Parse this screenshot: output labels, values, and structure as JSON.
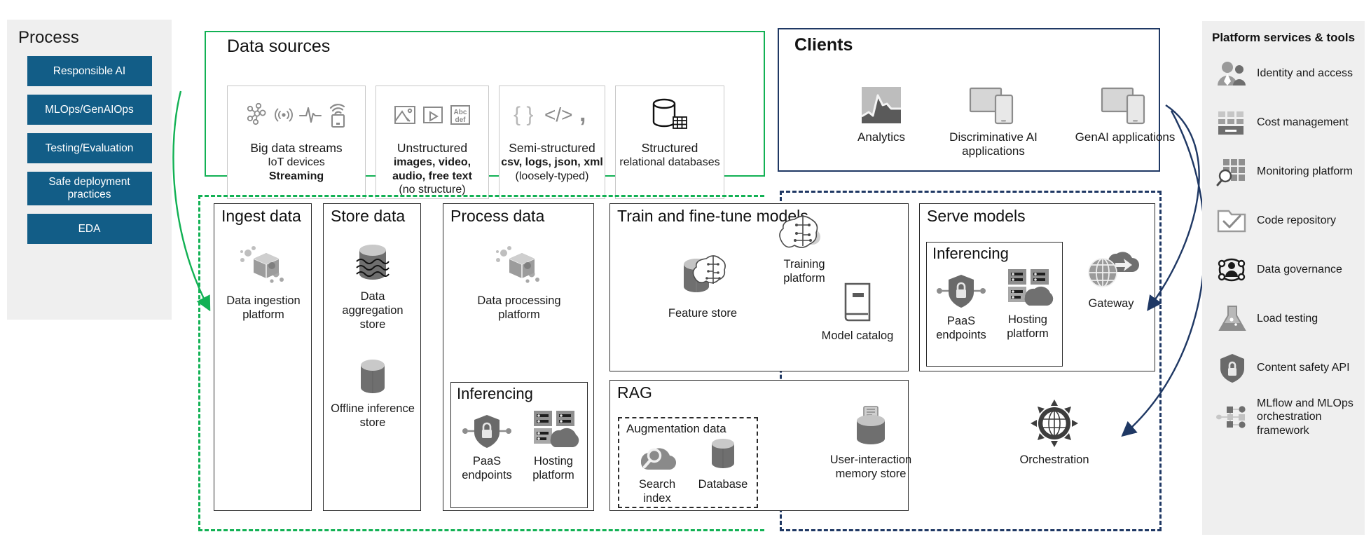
{
  "process": {
    "title": "Process",
    "items": [
      {
        "label": "Responsible AI"
      },
      {
        "label": "MLOps/GenAIOps"
      },
      {
        "label": "Testing/Evaluation"
      },
      {
        "label": "Safe deployment practices"
      },
      {
        "label": "EDA"
      }
    ]
  },
  "data_sources": {
    "title": "Data sources",
    "accent": "#12b154",
    "cards": [
      {
        "name": "big-data-streams",
        "line1": "Big data streams",
        "line2": "IoT devices",
        "line3": "Streaming",
        "icons": [
          "network-nodes-icon",
          "broadcast-signal-icon",
          "waveform-icon",
          "wifi-device-icon"
        ]
      },
      {
        "name": "unstructured",
        "line1": "Unstructured",
        "line2": "images, video, audio, free text",
        "line3": "(no structure)",
        "icons": [
          "image-icon",
          "video-icon",
          "abc-text-icon"
        ]
      },
      {
        "name": "semi-structured",
        "line1": "Semi-structured",
        "line2": "csv, logs, json, xml",
        "line3": "(loosely-typed)",
        "icons": [
          "braces-icon",
          "code-tag-icon",
          "comma-icon"
        ]
      },
      {
        "name": "structured",
        "line1": "Structured",
        "line2": "relational databases",
        "line3": "",
        "icons": [
          "database-table-icon"
        ]
      }
    ]
  },
  "clients": {
    "title": "Clients",
    "accent": "#1f3864",
    "items": [
      {
        "label": "Analytics",
        "icon": "analytics-chart-icon"
      },
      {
        "label": "Discriminative AI applications",
        "icon": "devices-icon"
      },
      {
        "label": "GenAI applications",
        "icon": "devices-icon"
      }
    ]
  },
  "workflow": {
    "green_accent": "#12b154",
    "blue_accent": "#1f3864",
    "stages": [
      {
        "name": "ingest-data",
        "title": "Ingest data",
        "nodes": [
          {
            "label": "Data ingestion platform",
            "icon": "data-ingestion-cube-icon"
          }
        ]
      },
      {
        "name": "store-data",
        "title": "Store data",
        "nodes": [
          {
            "label": "Data aggregation store",
            "icon": "data-lake-icon"
          },
          {
            "label": "Offline inference store",
            "icon": "cylinder-store-icon"
          }
        ]
      },
      {
        "name": "process-data",
        "title": "Process data",
        "nodes": [
          {
            "label": "Data processing platform",
            "icon": "data-processing-cube-icon"
          }
        ],
        "inferencing": {
          "title": "Inferencing",
          "nodes": [
            {
              "label": "PaaS endpoints",
              "icon": "shield-lock-endpoint-icon"
            },
            {
              "label": "Hosting platform",
              "icon": "server-cloud-icon"
            }
          ]
        }
      },
      {
        "name": "train-and-fine-tune-models",
        "title": "Train and fine-tune models",
        "nodes": [
          {
            "label": "Feature store",
            "icon": "feature-store-icon"
          },
          {
            "label": "Training platform",
            "icon": "brain-cloud-icon"
          },
          {
            "label": "Model catalog",
            "icon": "book-icon"
          }
        ]
      },
      {
        "name": "rag",
        "title": "RAG",
        "augmentation": {
          "title": "Augmentation data",
          "nodes": [
            {
              "label": "Search index",
              "icon": "search-cloud-icon"
            },
            {
              "label": "Database",
              "icon": "cylinder-store-icon"
            }
          ]
        },
        "nodes": [
          {
            "label": "User-interaction memory store",
            "icon": "memory-store-icon"
          },
          {
            "label": "Orchestration",
            "icon": "gear-orchestration-icon"
          }
        ]
      },
      {
        "name": "serve-models",
        "title": "Serve models",
        "inferencing": {
          "title": "Inferencing",
          "nodes": [
            {
              "label": "PaaS endpoints",
              "icon": "shield-lock-endpoint-icon"
            },
            {
              "label": "Hosting platform",
              "icon": "server-cloud-icon"
            }
          ]
        },
        "nodes": [
          {
            "label": "Gateway",
            "icon": "globe-cloud-gateway-icon"
          }
        ]
      }
    ]
  },
  "platform_services": {
    "title": "Platform services & tools",
    "items": [
      {
        "label": "Identity and access",
        "icon": "people-identity-icon"
      },
      {
        "label": "Cost management",
        "icon": "cost-grid-icon"
      },
      {
        "label": "Monitoring platform",
        "icon": "monitoring-magnifier-grid-icon"
      },
      {
        "label": "Code repository",
        "icon": "folder-check-icon"
      },
      {
        "label": "Data governance",
        "icon": "data-governance-person-icon"
      },
      {
        "label": "Load testing",
        "icon": "flask-icon"
      },
      {
        "label": "Content safety API",
        "icon": "shield-lock-icon"
      },
      {
        "label": "MLflow and MLOps orchestration framework",
        "icon": "pipeline-graph-icon"
      }
    ]
  }
}
